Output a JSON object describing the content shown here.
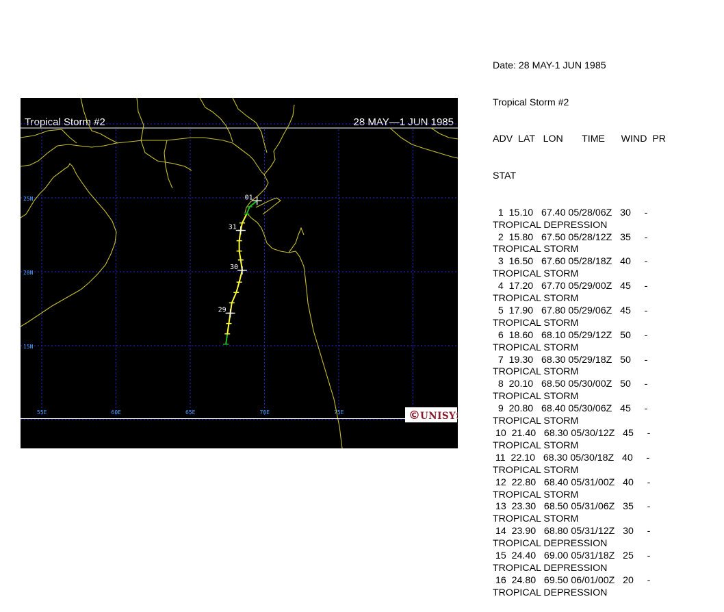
{
  "map": {
    "header_left": "Tropical Storm #2",
    "header_right": "28 MAY—1 JUN 1985",
    "logo_text": "UNISYS",
    "logo_icon": "copyright-icon",
    "colors": {
      "background": "#000000",
      "coast": "#c8c030",
      "grid": "#2828d8",
      "grid_label": "#4aa0ff",
      "track_depression": "#22bb22",
      "track_storm": "#ffff33",
      "frame": "#ffffff"
    },
    "lat_labels": [
      {
        "value": 25,
        "text": "25N"
      },
      {
        "value": 20,
        "text": "20N"
      },
      {
        "value": 15,
        "text": "15N"
      }
    ],
    "lon_labels": [
      {
        "value": 55,
        "text": "55E"
      },
      {
        "value": 60,
        "text": "60E"
      },
      {
        "value": 65,
        "text": "65E"
      },
      {
        "value": 70,
        "text": "70E"
      },
      {
        "value": 75,
        "text": "75E"
      }
    ],
    "day_labels": [
      {
        "text": "01",
        "lat": 24.8,
        "lon": 69.5
      },
      {
        "text": "31",
        "lat": 22.8,
        "lon": 68.4
      },
      {
        "text": "30",
        "lat": 20.1,
        "lon": 68.5
      },
      {
        "text": "29",
        "lat": 17.2,
        "lon": 67.7
      }
    ]
  },
  "info": {
    "date_line": "Date: 28 MAY-1 JUN 1985",
    "storm_line": "Tropical Storm #2",
    "header_line": "ADV  LAT   LON       TIME      WIND  PR",
    "header_stat": "STAT",
    "advisories": [
      {
        "line": "  1  15.10   67.40 05/28/06Z   30     -",
        "stat": "TROPICAL DEPRESSION",
        "lat": 15.1,
        "lon": 67.4
      },
      {
        "line": "  2  15.80   67.50 05/28/12Z   35     -",
        "stat": "TROPICAL STORM",
        "lat": 15.8,
        "lon": 67.5
      },
      {
        "line": "  3  16.50   67.60 05/28/18Z   40     -",
        "stat": "TROPICAL STORM",
        "lat": 16.5,
        "lon": 67.6
      },
      {
        "line": "  4  17.20   67.70 05/29/00Z   45     -",
        "stat": "TROPICAL STORM",
        "lat": 17.2,
        "lon": 67.7
      },
      {
        "line": "  5  17.90   67.80 05/29/06Z   45     -",
        "stat": "TROPICAL STORM",
        "lat": 17.9,
        "lon": 67.8
      },
      {
        "line": "  6  18.60   68.10 05/29/12Z   50     -",
        "stat": "TROPICAL STORM",
        "lat": 18.6,
        "lon": 68.1
      },
      {
        "line": "  7  19.30   68.30 05/29/18Z   50     -",
        "stat": "TROPICAL STORM",
        "lat": 19.3,
        "lon": 68.3
      },
      {
        "line": "  8  20.10   68.50 05/30/00Z   50     -",
        "stat": "TROPICAL STORM",
        "lat": 20.1,
        "lon": 68.5
      },
      {
        "line": "  9  20.80   68.40 05/30/06Z   45     -",
        "stat": "TROPICAL STORM",
        "lat": 20.8,
        "lon": 68.4
      },
      {
        "line": " 10  21.40   68.30 05/30/12Z   45     -",
        "stat": "TROPICAL STORM",
        "lat": 21.4,
        "lon": 68.3
      },
      {
        "line": " 11  22.10   68.30 05/30/18Z   40     -",
        "stat": "TROPICAL STORM",
        "lat": 22.1,
        "lon": 68.3
      },
      {
        "line": " 12  22.80   68.40 05/31/00Z   40     -",
        "stat": "TROPICAL STORM",
        "lat": 22.8,
        "lon": 68.4
      },
      {
        "line": " 13  23.30   68.50 05/31/06Z   35     -",
        "stat": "TROPICAL STORM",
        "lat": 23.3,
        "lon": 68.5
      },
      {
        "line": " 14  23.90   68.80 05/31/12Z   30     -",
        "stat": "TROPICAL DEPRESSION",
        "lat": 23.9,
        "lon": 68.8
      },
      {
        "line": " 15  24.40   69.00 05/31/18Z   25     -",
        "stat": "TROPICAL DEPRESSION",
        "lat": 24.4,
        "lon": 69.0
      },
      {
        "line": " 16  24.80   69.50 06/01/00Z   20     -",
        "stat": "TROPICAL DEPRESSION",
        "lat": 24.8,
        "lon": 69.5
      }
    ]
  }
}
